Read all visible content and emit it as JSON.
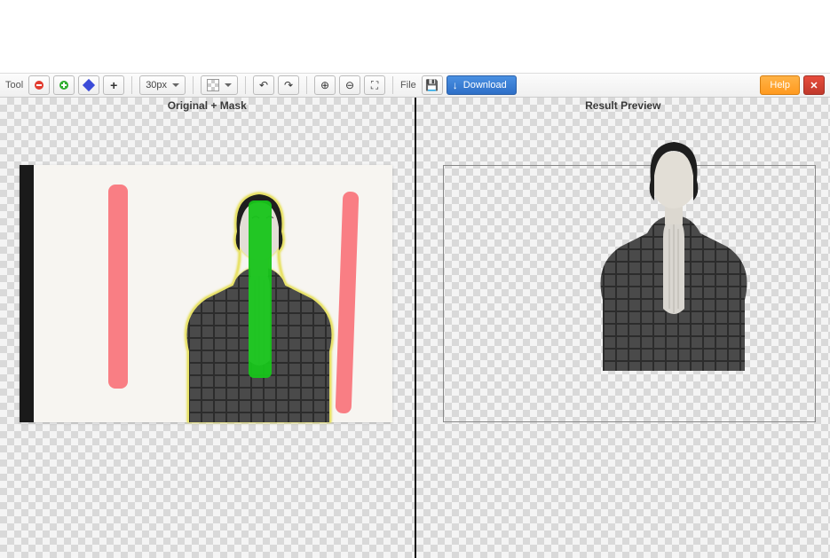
{
  "toolbar": {
    "tool_label": "Tool",
    "remove_tool": "remove",
    "keep_tool": "keep",
    "eraser_tool": "eraser",
    "hair_tool": "hair",
    "brush_size": "30px",
    "file_label": "File",
    "download_label": "Download",
    "help_label": "Help"
  },
  "panels": {
    "left_title": "Original + Mask",
    "right_title": "Result Preview"
  }
}
